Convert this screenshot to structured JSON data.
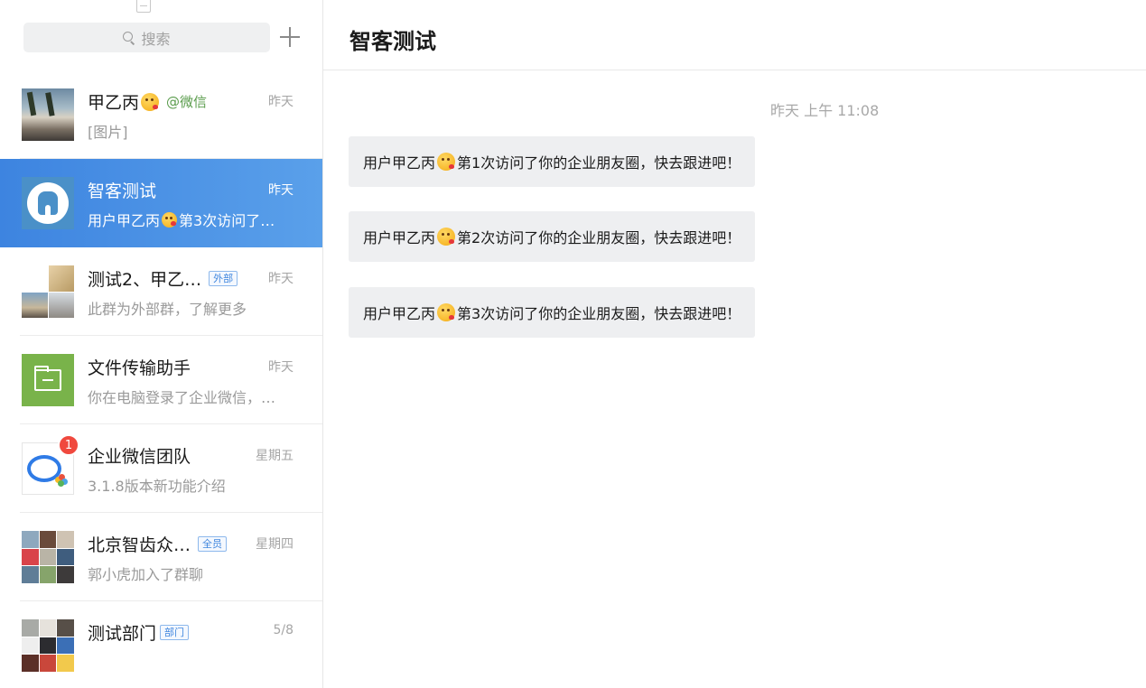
{
  "sidebar": {
    "search_placeholder": "搜索",
    "conversations": [
      {
        "name": "甲乙丙",
        "mention": "@微信",
        "preview": "[图片]",
        "time": "昨天"
      },
      {
        "name": "智客测试",
        "preview_prefix": "用户甲乙丙",
        "preview_suffix": "第3次访问了…",
        "time": "昨天"
      },
      {
        "name": "测试2、甲乙…",
        "tag": "外部",
        "preview": "此群为外部群，了解更多",
        "time": "昨天"
      },
      {
        "name": "文件传输助手",
        "preview": "你在电脑登录了企业微信，…",
        "time": "昨天"
      },
      {
        "name": "企业微信团队",
        "preview": "3.1.8版本新功能介绍",
        "time": "星期五",
        "unread": "1"
      },
      {
        "name": "北京智齿众…",
        "tag": "全员",
        "preview": "郭小虎加入了群聊",
        "time": "星期四"
      },
      {
        "name": "测试部门",
        "tag": "部门",
        "preview": "",
        "time": "5/8"
      }
    ]
  },
  "chat": {
    "title": "智客测试",
    "timestamp": "昨天 上午 11:08",
    "messages": [
      {
        "prefix": "用户甲乙丙",
        "suffix": "第1次访问了你的企业朋友圈，快去跟进吧！"
      },
      {
        "prefix": "用户甲乙丙",
        "suffix": "第2次访问了你的企业朋友圈，快去跟进吧！"
      },
      {
        "prefix": "用户甲乙丙",
        "suffix": "第3次访问了你的企业朋友圈，快去跟进吧！"
      }
    ]
  },
  "colors": {
    "selected_bg": "#3d84e0",
    "accent_blue": "#3f86de",
    "mention_green": "#5a9c4c",
    "badge_red": "#f0493e",
    "bubble_gray": "#eeeff1"
  }
}
